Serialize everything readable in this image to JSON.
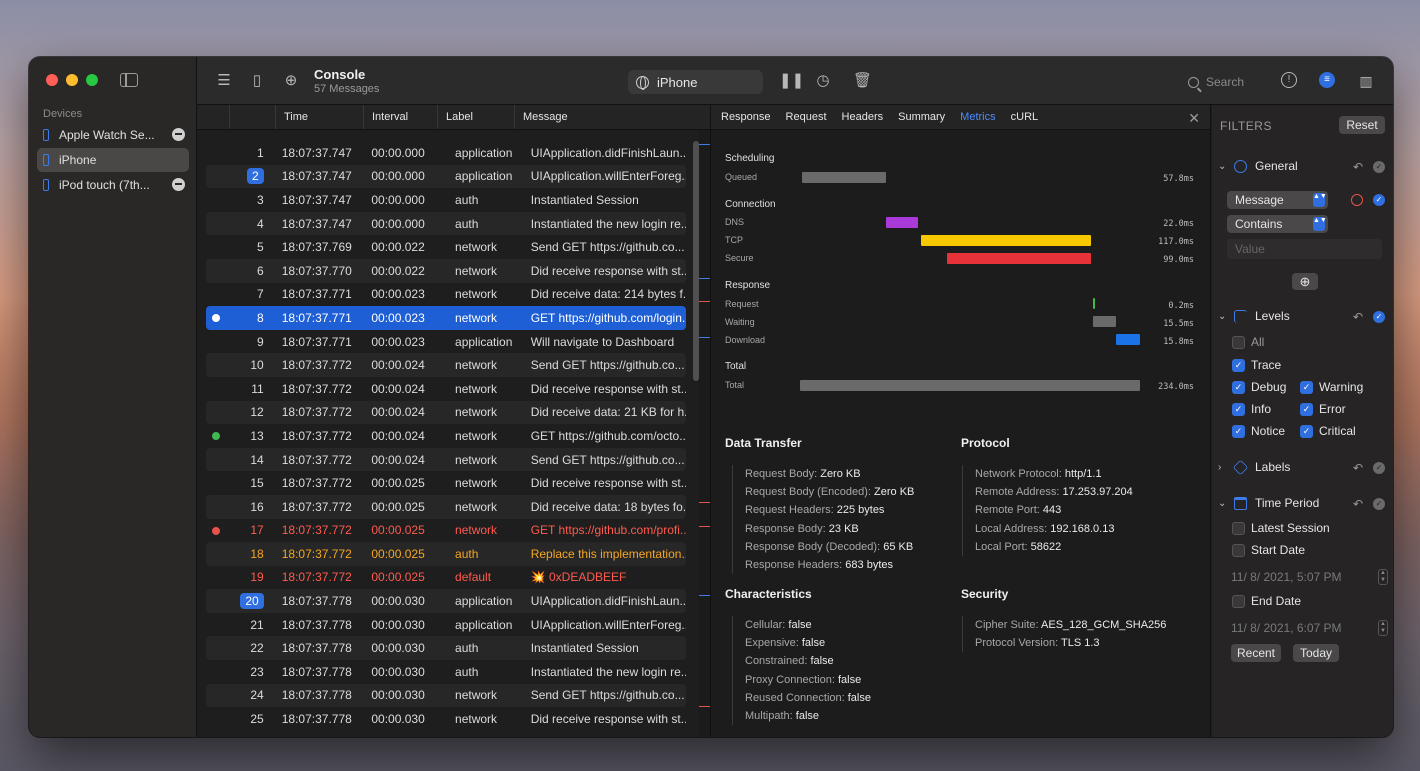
{
  "app": {
    "title": "Console",
    "subtitle": "57 Messages",
    "device": "iPhone",
    "search_placeholder": "Search"
  },
  "sidebar": {
    "title": "Devices",
    "devices": [
      {
        "label": "Apple Watch Se..."
      },
      {
        "label": "iPhone"
      },
      {
        "label": "iPod touch (7th..."
      }
    ]
  },
  "table": {
    "columns": [
      "Time",
      "Interval",
      "Label",
      "Message"
    ],
    "rows": [
      {
        "n": "1",
        "time": "18:07:37.747",
        "interval": "00:00.000",
        "label": "application",
        "msg": "UIApplication.didFinishLaun..."
      },
      {
        "n": "2",
        "time": "18:07:37.747",
        "interval": "00:00.000",
        "label": "application",
        "msg": "UIApplication.willEnterForeg..."
      },
      {
        "n": "3",
        "time": "18:07:37.747",
        "interval": "00:00.000",
        "label": "auth",
        "msg": "Instantiated Session"
      },
      {
        "n": "4",
        "time": "18:07:37.747",
        "interval": "00:00.000",
        "label": "auth",
        "msg": "Instantiated the new login re..."
      },
      {
        "n": "5",
        "time": "18:07:37.769",
        "interval": "00:00.022",
        "label": "network",
        "msg": "Send GET https://github.co..."
      },
      {
        "n": "6",
        "time": "18:07:37.770",
        "interval": "00:00.022",
        "label": "network",
        "msg": "Did receive response with st..."
      },
      {
        "n": "7",
        "time": "18:07:37.771",
        "interval": "00:00.023",
        "label": "network",
        "msg": "Did receive data: 214 bytes f..."
      },
      {
        "n": "8",
        "time": "18:07:37.771",
        "interval": "00:00.023",
        "label": "network",
        "msg": "GET https://github.com/login..."
      },
      {
        "n": "9",
        "time": "18:07:37.771",
        "interval": "00:00.023",
        "label": "application",
        "msg": "Will navigate to Dashboard"
      },
      {
        "n": "10",
        "time": "18:07:37.772",
        "interval": "00:00.024",
        "label": "network",
        "msg": "Send GET https://github.co..."
      },
      {
        "n": "11",
        "time": "18:07:37.772",
        "interval": "00:00.024",
        "label": "network",
        "msg": "Did receive response with st..."
      },
      {
        "n": "12",
        "time": "18:07:37.772",
        "interval": "00:00.024",
        "label": "network",
        "msg": "Did receive data: 21 KB for h..."
      },
      {
        "n": "13",
        "time": "18:07:37.772",
        "interval": "00:00.024",
        "label": "network",
        "msg": "GET https://github.com/octo..."
      },
      {
        "n": "14",
        "time": "18:07:37.772",
        "interval": "00:00.024",
        "label": "network",
        "msg": "Send GET https://github.co..."
      },
      {
        "n": "15",
        "time": "18:07:37.772",
        "interval": "00:00.025",
        "label": "network",
        "msg": "Did receive response with st..."
      },
      {
        "n": "16",
        "time": "18:07:37.772",
        "interval": "00:00.025",
        "label": "network",
        "msg": "Did receive data: 18 bytes fo..."
      },
      {
        "n": "17",
        "time": "18:07:37.772",
        "interval": "00:00.025",
        "label": "network",
        "msg": "GET https://github.com/profi..."
      },
      {
        "n": "18",
        "time": "18:07:37.772",
        "interval": "00:00.025",
        "label": "auth",
        "msg": "Replace this implementation..."
      },
      {
        "n": "19",
        "time": "18:07:37.772",
        "interval": "00:00.025",
        "label": "default",
        "msg": "💥 0xDEADBEEF"
      },
      {
        "n": "20",
        "time": "18:07:37.778",
        "interval": "00:00.030",
        "label": "application",
        "msg": "UIApplication.didFinishLaun..."
      },
      {
        "n": "21",
        "time": "18:07:37.778",
        "interval": "00:00.030",
        "label": "application",
        "msg": "UIApplication.willEnterForeg..."
      },
      {
        "n": "22",
        "time": "18:07:37.778",
        "interval": "00:00.030",
        "label": "auth",
        "msg": "Instantiated Session"
      },
      {
        "n": "23",
        "time": "18:07:37.778",
        "interval": "00:00.030",
        "label": "auth",
        "msg": "Instantiated the new login re..."
      },
      {
        "n": "24",
        "time": "18:07:37.778",
        "interval": "00:00.030",
        "label": "network",
        "msg": "Send GET https://github.co..."
      },
      {
        "n": "25",
        "time": "18:07:37.778",
        "interval": "00:00.030",
        "label": "network",
        "msg": "Did receive response with st..."
      }
    ]
  },
  "details": {
    "tabs": [
      "Response",
      "Request",
      "Headers",
      "Summary",
      "Metrics",
      "cURL"
    ],
    "active_tab": "Metrics",
    "timing": {
      "scheduling": "Scheduling",
      "queued": "Queued",
      "queued_val": "57.8ms",
      "connection": "Connection",
      "dns": "DNS",
      "dns_val": "22.0ms",
      "tcp": "TCP",
      "tcp_val": "117.0ms",
      "secure": "Secure",
      "secure_val": "99.0ms",
      "response": "Response",
      "request": "Request",
      "request_val": "0.2ms",
      "waiting": "Waiting",
      "waiting_val": "15.5ms",
      "download": "Download",
      "download_val": "15.8ms",
      "total_h": "Total",
      "total": "Total",
      "total_val": "234.0ms"
    },
    "data_transfer": {
      "title": "Data Transfer",
      "items": [
        {
          "k": "Request Body:",
          "v": "Zero KB"
        },
        {
          "k": "Request Body (Encoded):",
          "v": "Zero KB"
        },
        {
          "k": "Request Headers:",
          "v": "225 bytes"
        },
        {
          "k": "Response Body:",
          "v": "23 KB"
        },
        {
          "k": "Response Body (Decoded):",
          "v": "65 KB"
        },
        {
          "k": "Response Headers:",
          "v": "683 bytes"
        }
      ]
    },
    "protocol": {
      "title": "Protocol",
      "items": [
        {
          "k": "Network Protocol:",
          "v": "http/1.1"
        },
        {
          "k": "Remote Address:",
          "v": "17.253.97.204"
        },
        {
          "k": "Remote Port:",
          "v": "443"
        },
        {
          "k": "Local Address:",
          "v": "192.168.0.13"
        },
        {
          "k": "Local Port:",
          "v": "58622"
        }
      ]
    },
    "characteristics": {
      "title": "Characteristics",
      "items": [
        {
          "k": "Cellular:",
          "v": "false"
        },
        {
          "k": "Expensive:",
          "v": "false"
        },
        {
          "k": "Constrained:",
          "v": "false"
        },
        {
          "k": "Proxy Connection:",
          "v": "false"
        },
        {
          "k": "Reused Connection:",
          "v": "false"
        },
        {
          "k": "Multipath:",
          "v": "false"
        }
      ]
    },
    "security": {
      "title": "Security",
      "items": [
        {
          "k": "Cipher Suite:",
          "v": "AES_128_GCM_SHA256"
        },
        {
          "k": "Protocol Version:",
          "v": "TLS 1.3"
        }
      ]
    }
  },
  "filters": {
    "title": "FILTERS",
    "reset": "Reset",
    "general": "General",
    "field_select": "Message",
    "op_select": "Contains",
    "value_placeholder": "Value",
    "levels": "Levels",
    "level_items": {
      "all": "All",
      "trace": "Trace",
      "debug": "Debug",
      "warning": "Warning",
      "info": "Info",
      "error": "Error",
      "notice": "Notice",
      "critical": "Critical"
    },
    "labels": "Labels",
    "time_period": "Time Period",
    "latest_session": "Latest Session",
    "start_date": "Start Date",
    "start_value": "11/  8/ 2021,   5:07 PM",
    "end_date": "End Date",
    "end_value": "11/  8/ 2021,   6:07 PM",
    "recent": "Recent",
    "today": "Today"
  },
  "colors": {
    "accent": "#2f6fe0",
    "error": "#ff5b4f",
    "warning": "#f5a623",
    "dns": "#a93ad8",
    "tcp": "#f7c800",
    "secure": "#e8323a",
    "download": "#1a73e8"
  }
}
